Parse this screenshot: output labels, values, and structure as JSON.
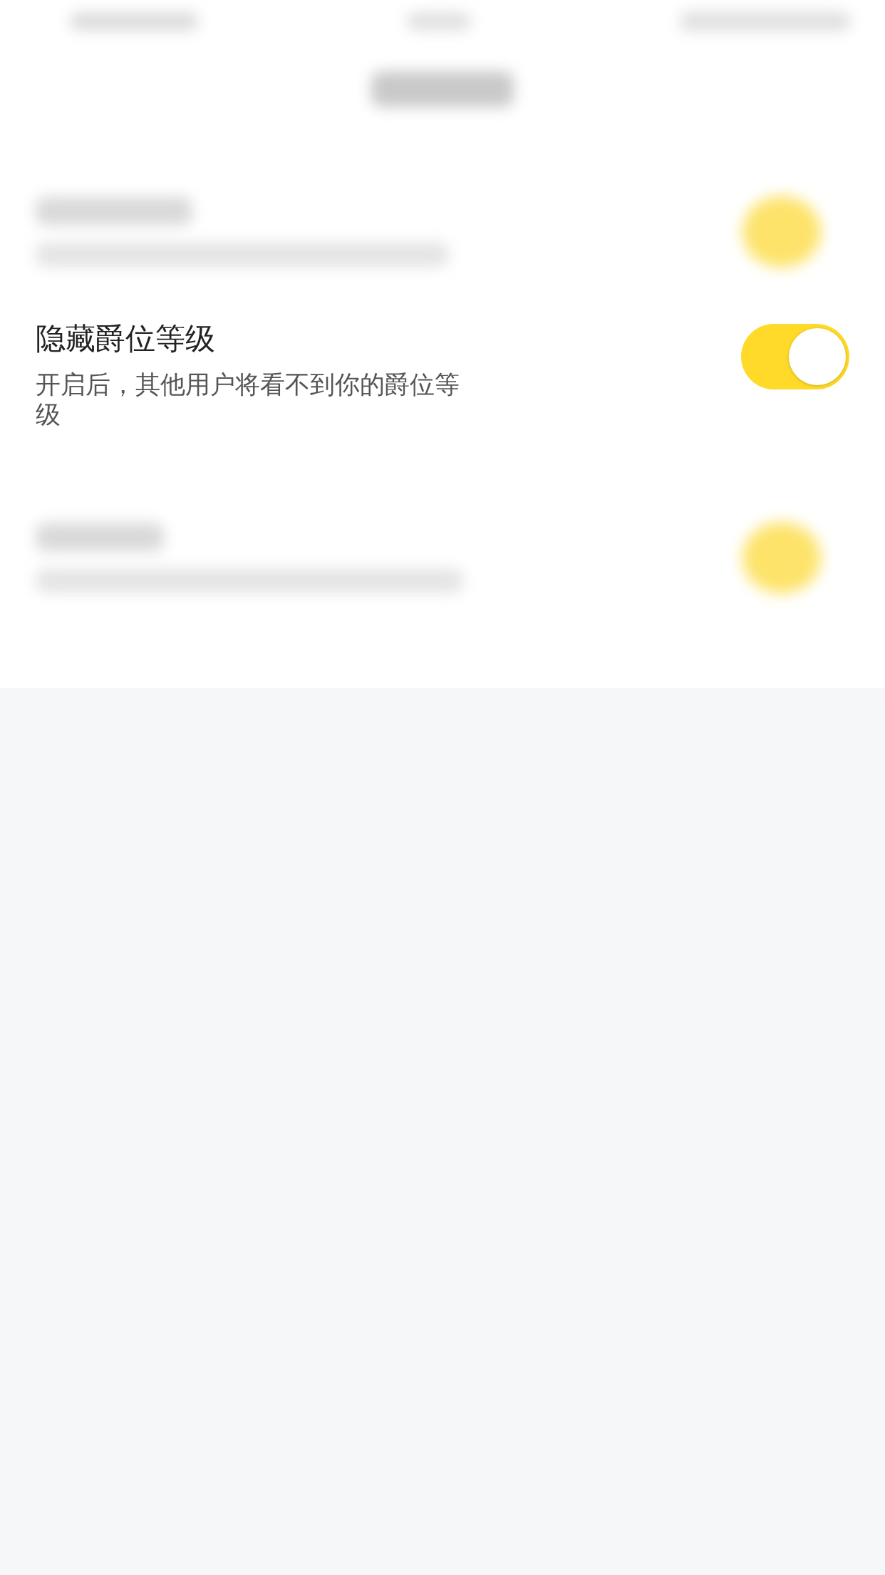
{
  "setting": {
    "title": "隐藏爵位等级",
    "description": "开启后，其他用户将看不到你的爵位等级",
    "on": true
  }
}
